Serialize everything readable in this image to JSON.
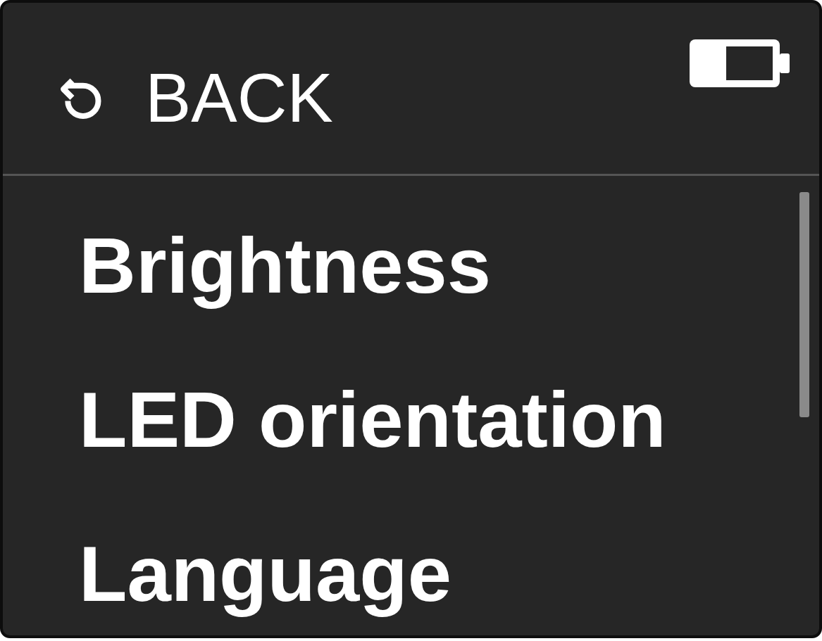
{
  "header": {
    "back_label": "BACK"
  },
  "menu": {
    "items": [
      {
        "label": "Brightness"
      },
      {
        "label": "LED orientation"
      },
      {
        "label": "Language"
      }
    ]
  }
}
